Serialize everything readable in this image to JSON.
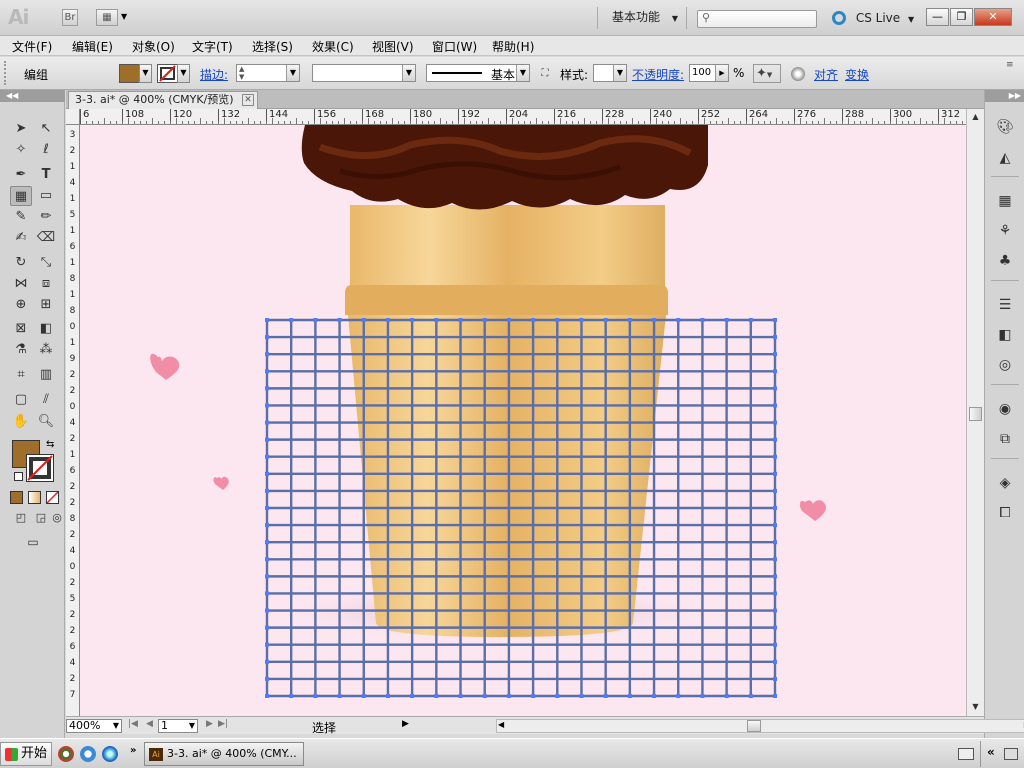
{
  "app": {
    "logo": "Ai",
    "bridge_label": "Br",
    "workspace": "基本功能",
    "cs_live": "CS Live",
    "window_buttons": [
      "—",
      "❐",
      "✕"
    ]
  },
  "menu": [
    "文件(F)",
    "编辑(E)",
    "对象(O)",
    "文字(T)",
    "选择(S)",
    "效果(C)",
    "视图(V)",
    "窗口(W)",
    "帮助(H)"
  ],
  "control_bar": {
    "selection_label": "编组",
    "fill_color": "#9e6e2a",
    "stroke_label": "描边:",
    "stroke_style_label": "基本",
    "style_label": "样式:",
    "opacity_label": "不透明度:",
    "opacity_value": "100",
    "opacity_unit": "%",
    "align_label": "对齐",
    "transform_label": "变换"
  },
  "document": {
    "tab_title": "3-3. ai* @ 400% (CMYK/预览)",
    "ruler_h": [
      "6",
      "108",
      "120",
      "132",
      "144",
      "156",
      "168",
      "180",
      "192",
      "204",
      "216",
      "228",
      "240",
      "252",
      "264",
      "276",
      "288",
      "300",
      "312"
    ],
    "ruler_v": [
      "3",
      "2",
      "1",
      "4",
      "1",
      "5",
      "1",
      "6",
      "1",
      "8",
      "1",
      "8",
      "0",
      "1",
      "9",
      "2",
      "2",
      "0",
      "4",
      "2",
      "1",
      "6",
      "2",
      "2",
      "8",
      "2",
      "4",
      "0",
      "2",
      "5",
      "2",
      "2",
      "6",
      "4",
      "2",
      "7"
    ],
    "canvas_bg": "#fce6f0",
    "grid_color": "#5a6ea8"
  },
  "status": {
    "zoom": "400%",
    "page": "1",
    "tool_status": "选择"
  },
  "taskbar": {
    "start": "开始",
    "task_item": "3-3. ai* @ 400% (CMY..."
  }
}
